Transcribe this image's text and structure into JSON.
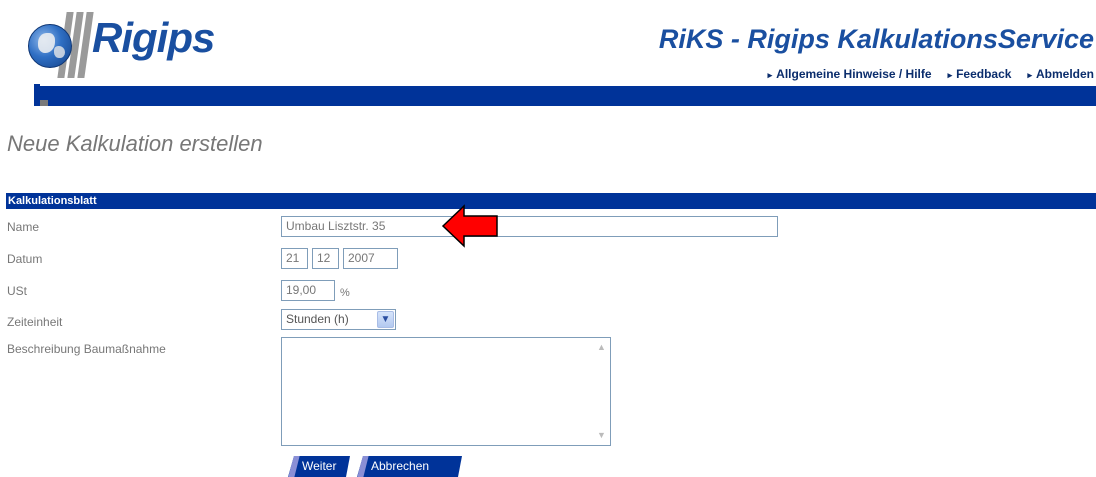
{
  "brand": {
    "logo_text": "Rigips",
    "service_title": "RiKS - Rigips KalkulationsService"
  },
  "nav": {
    "links": [
      {
        "label": "Allgemeine Hinweise / Hilfe"
      },
      {
        "label": "Feedback"
      },
      {
        "label": "Abmelden"
      }
    ]
  },
  "page": {
    "title": "Neue Kalkulation erstellen"
  },
  "form": {
    "section_title": "Kalkulationsblatt",
    "name": {
      "label": "Name",
      "value": "Umbau Lisztstr. 35"
    },
    "datum": {
      "label": "Datum",
      "day": "21",
      "month": "12",
      "year": "2007"
    },
    "ust": {
      "label": "USt",
      "value": "19,00",
      "unit": "%"
    },
    "zeiteinheit": {
      "label": "Zeiteinheit",
      "selected": "Stunden (h)"
    },
    "beschreibung": {
      "label": "Beschreibung Baumaßnahme",
      "value": ""
    },
    "buttons": {
      "next": "Weiter",
      "cancel": "Abbrechen"
    }
  },
  "annotation": {
    "arrow_color": "#ff0000"
  },
  "colors": {
    "brand_blue": "#003399",
    "logo_blue": "#1a4fa0"
  }
}
